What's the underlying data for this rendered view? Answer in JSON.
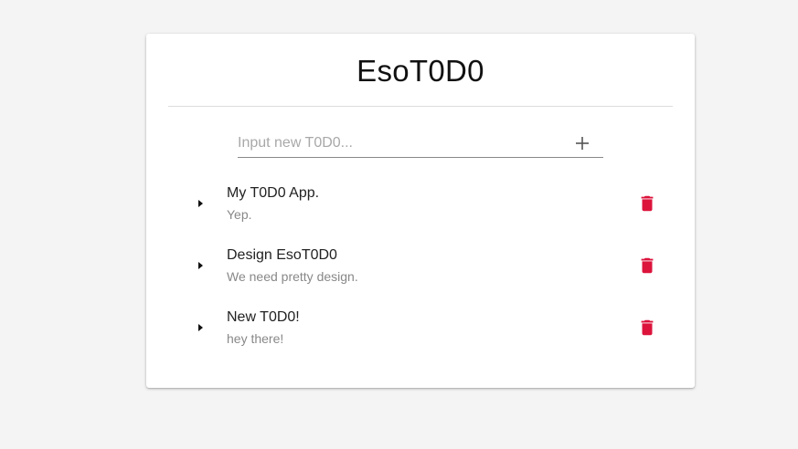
{
  "app": {
    "title": "EsoT0D0"
  },
  "new_todo": {
    "placeholder": "Input new T0D0...",
    "value": "",
    "add_icon": "plus-icon"
  },
  "todos": [
    {
      "title": "My T0D0 App.",
      "description": "Yep."
    },
    {
      "title": "Design EsoT0D0",
      "description": "We need pretty design."
    },
    {
      "title": "New T0D0!",
      "description": "hey there!"
    }
  ],
  "icons": {
    "expand": "caret-right-icon",
    "delete": "trash-icon"
  },
  "colors": {
    "delete": "#dc143c",
    "background": "#f4f4f4",
    "card": "#ffffff"
  }
}
